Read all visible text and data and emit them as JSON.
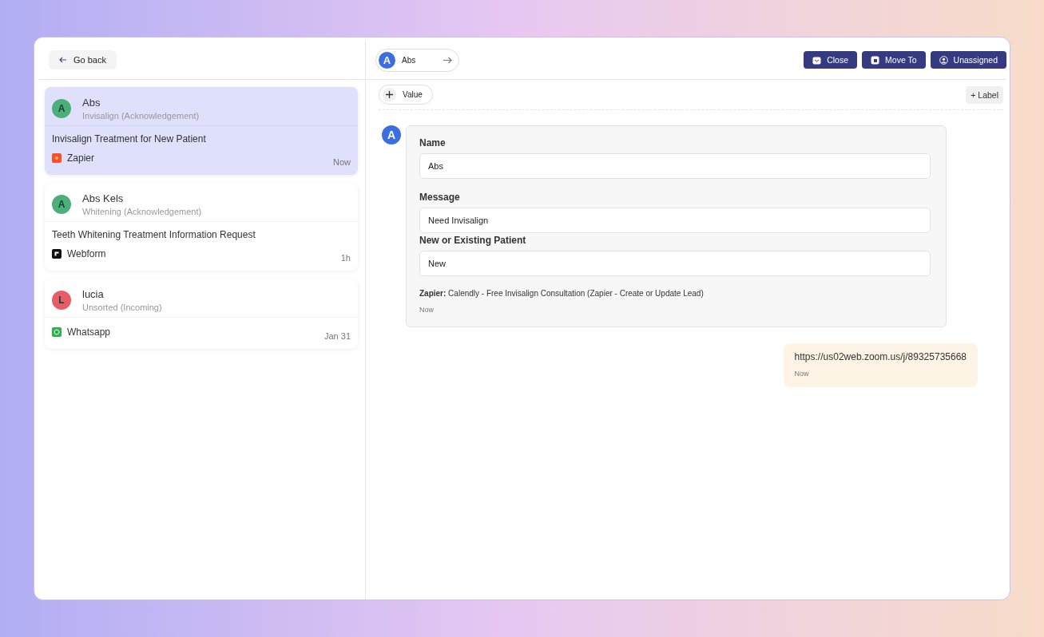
{
  "back_button": {
    "label": "Go back"
  },
  "conversations": [
    {
      "name": "Abs",
      "initial": "A",
      "color": "#4caf7a",
      "pipeline": "Invisalign (Acknowledgement)",
      "subject": "Invisalign Treatment for New Patient",
      "channel": {
        "kind": "zapier",
        "label": "Zapier"
      },
      "time": "Now",
      "selected": true
    },
    {
      "name": "Abs Kels",
      "initial": "A",
      "color": "#4caf7a",
      "pipeline": "Whitening (Acknowledgement)",
      "subject": "Teeth Whitening Treatment Information Request",
      "channel": {
        "kind": "webform",
        "label": "Webform"
      },
      "time": "1h",
      "selected": false
    },
    {
      "name": "lucia",
      "initial": "L",
      "color": "#e85c68",
      "pipeline": "Unsorted (Incoming)",
      "channel": {
        "kind": "whatsapp",
        "label": "Whatsapp"
      },
      "time": "Jan 31",
      "selected": false
    }
  ],
  "contact_chip": {
    "initial": "A",
    "name": "Abs"
  },
  "actions": [
    {
      "kind": "close",
      "label": "Close"
    },
    {
      "kind": "move",
      "label": "Move To"
    },
    {
      "kind": "user",
      "label": "Unassigned"
    }
  ],
  "value_button": {
    "label": "Value"
  },
  "label_button": {
    "label": "+ Label"
  },
  "form_message": {
    "initial": "A",
    "fields": [
      {
        "label": "Name",
        "value": "Abs"
      },
      {
        "label": "Message",
        "value": "Need Invisalign"
      },
      {
        "label": "New or Existing Patient",
        "value": "New"
      }
    ],
    "source": "**Zapier:** Calendly - Free Invisalign Consultation (Zapier - Create or Update Lead)",
    "time": "Now"
  },
  "reply_message": {
    "text": "https://us02web.zoom.us/j/89325735668",
    "time": "Now"
  }
}
